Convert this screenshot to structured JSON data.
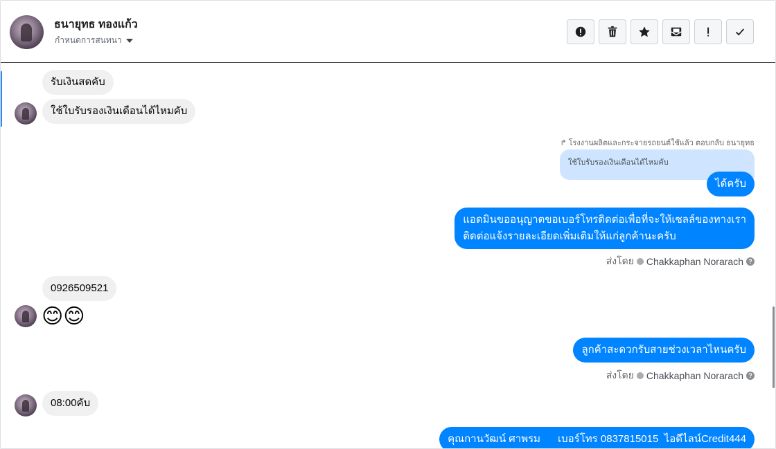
{
  "header": {
    "contact_name": "ธนายุทธ ทองแก้ว",
    "conversation_label": "กำหนดการสนทนา",
    "toolbar": [
      {
        "icon": "alert-circle-icon",
        "label": "Mark as spam"
      },
      {
        "icon": "trash-icon",
        "label": "Delete"
      },
      {
        "icon": "star-icon",
        "label": "Star"
      },
      {
        "icon": "mail-open-icon",
        "label": "Mark unread"
      },
      {
        "icon": "exclamation-icon",
        "label": "Follow up"
      },
      {
        "icon": "check-icon",
        "label": "Done"
      }
    ]
  },
  "messages": {
    "m1": "รับเงินสดคับ",
    "m2": "ใช้ใบรับรองเงินเดือนได้ไหมคับ",
    "reply_meta": "โรงงานผลิตและกระจายรถยนต์ใช้แล้ว ตอบกลับ ธนายุทธ",
    "quoted": "ใช้ใบรับรองเงินเดือนได้ไหมคับ",
    "m3": "ได้ครับ",
    "m4_line1": "แอดมินขออนุญาตขอเบอร์โทรติดต่อเพื่อที่จะให้เซลล์ของทางเรา",
    "m4_line2": "ติดต่อแจ้งรายละเอียดเพิ่มเติมให้แก่ลูกค้านะครับ",
    "sent_by_1_prefix": "ส่งโดย",
    "sent_by_1_agent": "Chakkaphan Norarach",
    "m5": "0926509521",
    "m6": "😊😊",
    "m7": "ลูกค้าสะดวกรับสายช่วงเวลาไหนครับ",
    "sent_by_2_prefix": "ส่งโดย",
    "sent_by_2_agent": "Chakkaphan Norarach",
    "m8": "08:00คับ",
    "m9": "คุณกานวัฒน์ ศาพรม      เบอร์โทร 0837815015  ไอดีไลน์Credit444"
  },
  "colors": {
    "outgoing": "#0084ff",
    "incoming": "#f0f0f0",
    "quoted": "#cfe5ff",
    "accent": "#2d88ff"
  }
}
